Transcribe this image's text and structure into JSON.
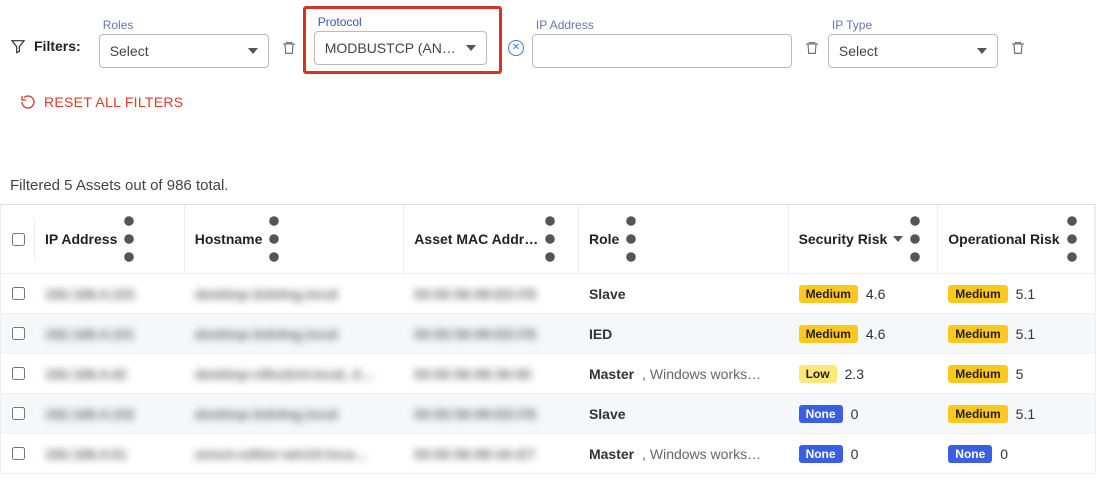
{
  "filters_label": "Filters:",
  "filters": {
    "roles": {
      "label": "Roles",
      "value": "Select"
    },
    "protocol": {
      "label": "Protocol",
      "value": "MODBUSTCP (AN…"
    },
    "ip": {
      "label": "IP Address",
      "value": ""
    },
    "iptype": {
      "label": "IP Type",
      "value": "Select"
    }
  },
  "reset_label": "RESET ALL FILTERS",
  "result_count_text": "Filtered 5 Assets out of 986 total.",
  "columns": {
    "ip": "IP Address",
    "host": "Hostname",
    "mac": "Asset MAC Addr…",
    "role": "Role",
    "sec": "Security Risk",
    "op": "Operational Risk"
  },
  "rows": [
    {
      "ip": "192.168.4.103",
      "host": "desktop-2eb4ng.local",
      "mac": "00:50:56:99:ED:FE",
      "role": "Slave",
      "role_sub": "",
      "sec_level": "Medium",
      "sec_val": "4.6",
      "op_level": "Medium",
      "op_val": "5.1"
    },
    {
      "ip": "192.168.4.101",
      "host": "desktop-2eb4ng.local",
      "mac": "00:50:56:99:ED:FE",
      "role": "IED",
      "role_sub": "",
      "sec_level": "Medium",
      "sec_val": "4.6",
      "op_level": "Medium",
      "op_val": "5.1"
    },
    {
      "ip": "192.168.4.42",
      "host": "desktop-rdhu2n4.local, d…",
      "mac": "00:50:56:99:36:00",
      "role": "Master",
      "role_sub": ", Windows works…",
      "sec_level": "Low",
      "sec_val": "2.3",
      "op_level": "Medium",
      "op_val": "5"
    },
    {
      "ip": "192.168.4.102",
      "host": "desktop-2eb4ng.local",
      "mac": "00:50:56:99:ED:FE",
      "role": "Slave",
      "role_sub": "",
      "sec_level": "None",
      "sec_val": "0",
      "op_level": "Medium",
      "op_val": "5.1"
    },
    {
      "ip": "192.168.4.51",
      "host": "zenon-editor-win10.loca…",
      "mac": "00:50:56:99:4A:E7",
      "role": "Master",
      "role_sub": ", Windows works…",
      "sec_level": "None",
      "sec_val": "0",
      "op_level": "None",
      "op_val": "0"
    }
  ],
  "badge_class": {
    "Medium": "badge-medium",
    "Low": "badge-low",
    "None": "badge-none"
  }
}
